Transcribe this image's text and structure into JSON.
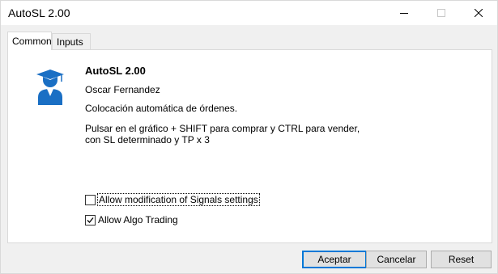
{
  "window": {
    "title": "AutoSL 2.00"
  },
  "tabs": [
    {
      "label": "Common",
      "active": true
    },
    {
      "label": "Inputs",
      "active": false
    }
  ],
  "program": {
    "icon": "graduate-user-icon",
    "name": "AutoSL 2.00",
    "author": "Oscar Fernandez",
    "description": "Colocación automática de órdenes.",
    "instructions_line1": "Pulsar en el gráfico + SHIFT para comprar y CTRL para vender,",
    "instructions_line2": "con SL determinado y TP x 3"
  },
  "options": [
    {
      "label": "Allow modification of Signals settings",
      "checked": false
    },
    {
      "label": "Allow Algo Trading",
      "checked": true
    }
  ],
  "buttons": {
    "ok": "Aceptar",
    "cancel": "Cancelar",
    "reset": "Reset"
  },
  "colors": {
    "accent": "#0078d7",
    "icon_blue": "#1a6fc4"
  }
}
